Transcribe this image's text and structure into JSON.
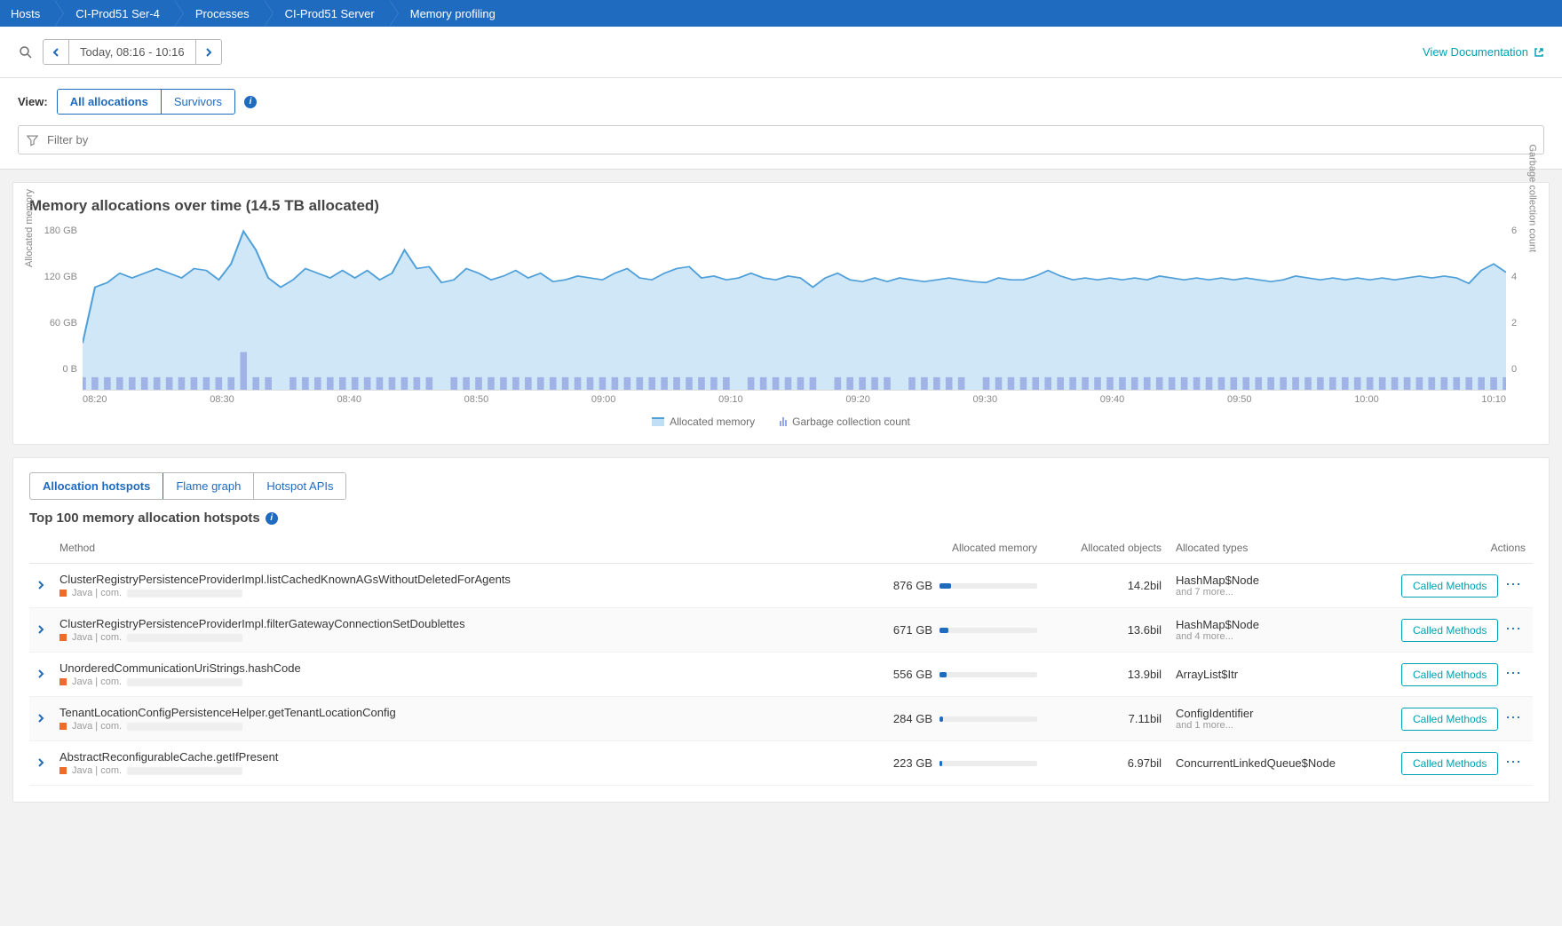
{
  "breadcrumb": [
    "Hosts",
    "CI-Prod51 Ser-4",
    "Processes",
    "CI-Prod51 Server",
    "Memory profiling"
  ],
  "timeframe": {
    "label": "Today, 08:16 - 10:16"
  },
  "doc_link": "View Documentation",
  "view": {
    "label": "View:",
    "options": [
      "All allocations",
      "Survivors"
    ],
    "active": 0
  },
  "filter_placeholder": "Filter by",
  "chart": {
    "title": "Memory allocations over time (14.5 TB allocated)",
    "y_left_label": "Allocated memory",
    "y_right_label": "Garbage collection count",
    "legend": [
      "Allocated memory",
      "Garbage collection count"
    ]
  },
  "chart_data": {
    "type": "area+bar",
    "x_ticks": [
      "08:20",
      "08:30",
      "08:40",
      "08:50",
      "09:00",
      "09:10",
      "09:20",
      "09:30",
      "09:40",
      "09:50",
      "10:00",
      "10:10"
    ],
    "y_left_ticks": [
      "180 GB",
      "120 GB",
      "60 GB",
      "0 B"
    ],
    "y_right_ticks": [
      "6",
      "4",
      "2",
      "0"
    ],
    "y_left_range": [
      0,
      180
    ],
    "y_right_range": [
      0,
      6
    ],
    "series": [
      {
        "name": "Allocated memory",
        "axis": "left",
        "unit": "GB",
        "values": [
          50,
          110,
          115,
          125,
          120,
          125,
          130,
          125,
          120,
          130,
          128,
          118,
          135,
          170,
          150,
          120,
          110,
          118,
          130,
          125,
          120,
          128,
          120,
          128,
          118,
          125,
          150,
          130,
          132,
          115,
          118,
          130,
          125,
          118,
          122,
          128,
          120,
          125,
          116,
          118,
          122,
          120,
          118,
          125,
          130,
          120,
          118,
          125,
          130,
          132,
          120,
          122,
          118,
          120,
          125,
          120,
          118,
          122,
          120,
          110,
          120,
          125,
          118,
          116,
          120,
          116,
          120,
          118,
          116,
          118,
          120,
          118,
          116,
          115,
          120,
          118,
          118,
          122,
          128,
          122,
          118,
          120,
          118,
          120,
          118,
          120,
          118,
          122,
          120,
          118,
          120,
          118,
          120,
          118,
          120,
          118,
          116,
          118,
          122,
          120,
          118,
          120,
          118,
          120,
          118,
          120,
          118,
          120,
          122,
          120,
          122,
          120,
          114,
          128,
          135,
          126
        ]
      },
      {
        "name": "Garbage collection count",
        "axis": "right",
        "unit": "count",
        "values": [
          1,
          1,
          1,
          1,
          1,
          1,
          1,
          1,
          1,
          1,
          1,
          1,
          1,
          3,
          1,
          1,
          0,
          1,
          1,
          1,
          1,
          1,
          1,
          1,
          1,
          1,
          1,
          1,
          1,
          0,
          1,
          1,
          1,
          1,
          1,
          1,
          1,
          1,
          1,
          1,
          1,
          1,
          1,
          1,
          1,
          1,
          1,
          1,
          1,
          1,
          1,
          1,
          1,
          0,
          1,
          1,
          1,
          1,
          1,
          1,
          0,
          1,
          1,
          1,
          1,
          1,
          0,
          1,
          1,
          1,
          1,
          1,
          0,
          1,
          1,
          1,
          1,
          1,
          1,
          1,
          1,
          1,
          1,
          1,
          1,
          1,
          1,
          1,
          1,
          1,
          1,
          1,
          1,
          1,
          1,
          1,
          1,
          1,
          1,
          1,
          1,
          1,
          1,
          1,
          1,
          1,
          1,
          1,
          1,
          1,
          1,
          1,
          1,
          1,
          1,
          1
        ]
      }
    ]
  },
  "hotspot_tabs": {
    "options": [
      "Allocation hotspots",
      "Flame graph",
      "Hotspot APIs"
    ],
    "active": 0
  },
  "hotspot_title": "Top 100 memory allocation hotspots",
  "columns": {
    "method": "Method",
    "alloc_mem": "Allocated memory",
    "alloc_obj": "Allocated objects",
    "alloc_types": "Allocated types",
    "actions": "Actions"
  },
  "action_button": "Called Methods",
  "tech_label": "Java | com.",
  "rows": [
    {
      "method": "ClusterRegistryPersistenceProviderImpl.listCachedKnownAGsWithoutDeletedForAgents",
      "mem": "876 GB",
      "bar": 12,
      "obj": "14.2bil",
      "type": "HashMap$Node",
      "type_more": "and 7 more..."
    },
    {
      "method": "ClusterRegistryPersistenceProviderImpl.filterGatewayConnectionSetDoublettes",
      "mem": "671 GB",
      "bar": 9,
      "obj": "13.6bil",
      "type": "HashMap$Node",
      "type_more": "and 4 more..."
    },
    {
      "method": "UnorderedCommunicationUriStrings.hashCode",
      "mem": "556 GB",
      "bar": 7,
      "obj": "13.9bil",
      "type": "ArrayList$Itr",
      "type_more": ""
    },
    {
      "method": "TenantLocationConfigPersistenceHelper.getTenantLocationConfig",
      "mem": "284 GB",
      "bar": 4,
      "obj": "7.11bil",
      "type": "ConfigIdentifier",
      "type_more": "and 1 more..."
    },
    {
      "method": "AbstractReconfigurableCache.getIfPresent",
      "mem": "223 GB",
      "bar": 3,
      "obj": "6.97bil",
      "type": "ConcurrentLinkedQueue$Node",
      "type_more": ""
    }
  ]
}
